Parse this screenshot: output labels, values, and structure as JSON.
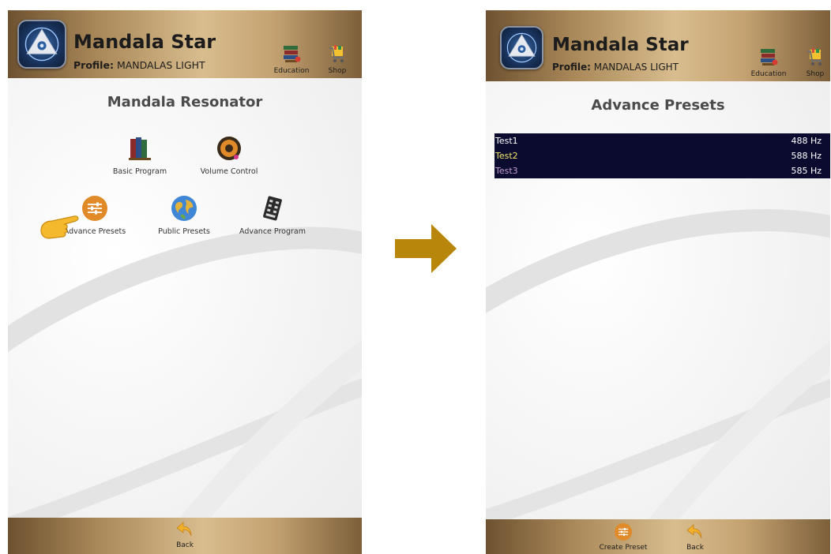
{
  "left_screen": {
    "app_title": "Mandala Star",
    "profile_label": "Profile:",
    "profile_name": "MANDALAS LIGHT",
    "header_buttons": [
      {
        "label": "Education",
        "icon": "books-icon"
      },
      {
        "label": "Shop",
        "icon": "shopping-cart-icon"
      }
    ],
    "page_title": "Mandala Resonator",
    "menu_items": [
      {
        "label": "Basic Program",
        "icon": "books-icon"
      },
      {
        "label": "Volume Control",
        "icon": "speaker-icon"
      },
      {
        "label": "Advance Presets",
        "icon": "sliders-icon"
      },
      {
        "label": "Public Presets",
        "icon": "globe-icon"
      },
      {
        "label": "Advance Program",
        "icon": "keypad-icon"
      }
    ],
    "footer_buttons": [
      {
        "label": "Back",
        "icon": "back-arrow-icon"
      }
    ],
    "pointer_icon": "pointing-hand-icon"
  },
  "transition_icon": "right-arrow-icon",
  "right_screen": {
    "app_title": "Mandala Star",
    "profile_label": "Profile:",
    "profile_name": "MANDALAS LIGHT",
    "header_buttons": [
      {
        "label": "Education",
        "icon": "books-icon"
      },
      {
        "label": "Shop",
        "icon": "shopping-cart-icon"
      }
    ],
    "page_title": "Advance Presets",
    "presets": [
      {
        "name": "Test1",
        "frequency": "488 Hz"
      },
      {
        "name": "Test2",
        "frequency": "588 Hz"
      },
      {
        "name": "Test3",
        "frequency": "585 Hz"
      }
    ],
    "footer_buttons": [
      {
        "label": "Create Preset",
        "icon": "sliders-icon"
      },
      {
        "label": "Back",
        "icon": "back-arrow-icon"
      }
    ]
  },
  "colors": {
    "header_gold": "#d9bd8e",
    "header_bronze": "#6e5230",
    "list_background": "#0b0b30",
    "selected_text": "#f4e56b",
    "dim_text": "#c49cd2",
    "icon_orange": "#e08a2a",
    "arrow_gold": "#b8860b"
  }
}
